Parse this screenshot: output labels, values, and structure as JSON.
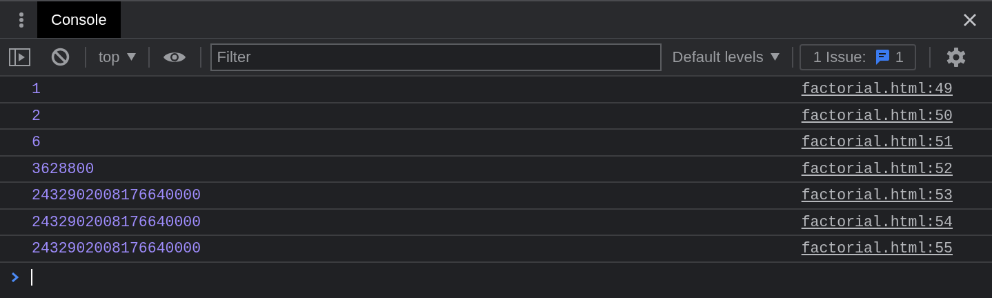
{
  "tabs": [
    {
      "label": "Console",
      "selected": true
    }
  ],
  "toolbar": {
    "context": "top",
    "filter": {
      "placeholder": "Filter"
    },
    "levels": "Default levels",
    "issues": {
      "label": "1 Issue:",
      "count": "1"
    }
  },
  "messages": [
    {
      "value": "1",
      "source": "factorial.html:49"
    },
    {
      "value": "2",
      "source": "factorial.html:50"
    },
    {
      "value": "6",
      "source": "factorial.html:51"
    },
    {
      "value": "3628800",
      "source": "factorial.html:52"
    },
    {
      "value": "2432902008176640000",
      "source": "factorial.html:53"
    },
    {
      "value": "2432902008176640000",
      "source": "factorial.html:54"
    },
    {
      "value": "2432902008176640000",
      "source": "factorial.html:55"
    }
  ]
}
